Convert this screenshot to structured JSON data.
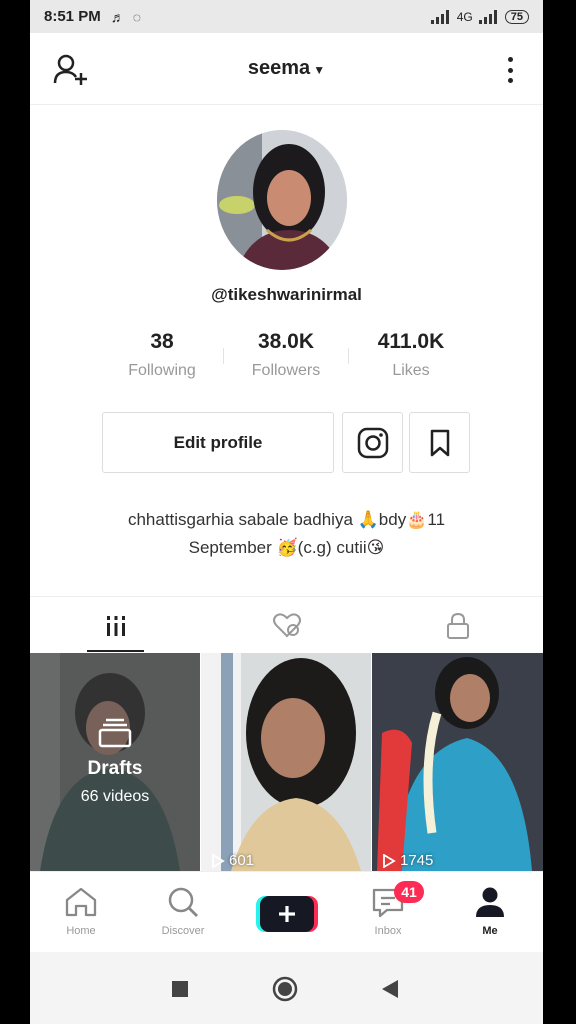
{
  "status_bar": {
    "time": "8:51 PM",
    "battery": "75",
    "network": "4G"
  },
  "header": {
    "title": "seema"
  },
  "profile": {
    "handle": "@tikeshwarinirmal",
    "stats": [
      {
        "value": "38",
        "label": "Following"
      },
      {
        "value": "38.0K",
        "label": "Followers"
      },
      {
        "value": "411.0K",
        "label": "Likes"
      }
    ],
    "edit_label": "Edit profile",
    "bio_line1": "chhattisgarhia sabale badhiya 🙏bdy🎂11",
    "bio_line2": "September 🥳(c.g) cutii😘"
  },
  "grid": {
    "drafts_label": "Drafts",
    "drafts_count": "66 videos",
    "videos": [
      {
        "views": "601"
      },
      {
        "views": "1745"
      }
    ]
  },
  "bottom_nav": {
    "items": [
      {
        "label": "Home"
      },
      {
        "label": "Discover"
      },
      {
        "label": "Inbox"
      },
      {
        "label": "Me"
      }
    ],
    "inbox_badge": "41"
  },
  "colors": {
    "accent": "#fe2c55",
    "cyan": "#25f4ee"
  }
}
